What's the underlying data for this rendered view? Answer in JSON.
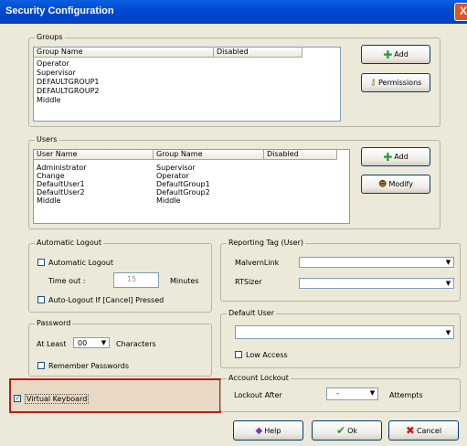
{
  "window": {
    "title": "Security Configuration",
    "close_label": "X"
  },
  "groups": {
    "caption": "Groups",
    "columns": [
      "Group Name",
      "Disabled"
    ],
    "rows": [
      "Operator",
      "Supervisor",
      "DEFAULTGROUP1",
      "DEFAULTGROUP2",
      "Middle"
    ],
    "add_label": "Add",
    "permissions_label": "Permissions"
  },
  "users": {
    "caption": "Users",
    "columns": [
      "User Name",
      "Group Name",
      "Disabled"
    ],
    "rows": [
      {
        "user": "Administrator",
        "group": "Supervisor"
      },
      {
        "user": "Change",
        "group": "Operator"
      },
      {
        "user": "DefaultUser1",
        "group": "DefaultGroup1"
      },
      {
        "user": "DefaultUser2",
        "group": "DefaultGroup2"
      },
      {
        "user": "Middle",
        "group": "Middle"
      }
    ],
    "add_label": "Add",
    "modify_label": "Modify"
  },
  "auto_logout": {
    "caption": "Automatic Logout",
    "automatic_logout_label": "Automatic Logout",
    "timeout_label": "Time out :",
    "timeout_value": "15",
    "minutes_label": "Minutes",
    "auto_logout_cancel_label": "Auto-Logout If [Cancel] Pressed"
  },
  "password": {
    "caption": "Password",
    "at_least_label": "At Least",
    "at_least_value": "00",
    "characters_label": "Characters",
    "remember_label": "Remember Passwords"
  },
  "virtual_keyboard": {
    "label": "Virtual Keyboard",
    "checked": true
  },
  "reporting_tag": {
    "caption": "Reporting Tag (User)",
    "malvernlink_label": "MalvernLink",
    "rtsizer_label": "RTSizer"
  },
  "default_user": {
    "caption": "Default User",
    "low_access_label": "Low Access"
  },
  "account_lockout": {
    "caption": "Account Lockout",
    "lockout_after_label": "Lockout After",
    "lockout_value": "-",
    "attempts_label": "Attempts"
  },
  "footer": {
    "help_label": "Help",
    "ok_label": "Ok",
    "cancel_label": "Cancel"
  }
}
